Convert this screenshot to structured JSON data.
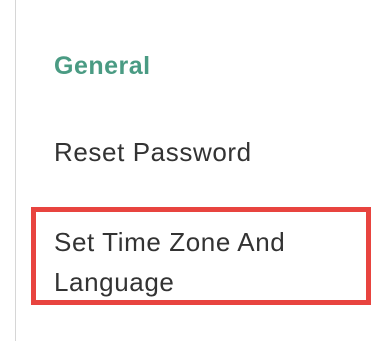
{
  "sidebar": {
    "section_title": "General",
    "items": [
      {
        "label": "Reset Password"
      },
      {
        "label": "Set Time Zone And Language"
      }
    ]
  },
  "colors": {
    "section_title": "#4a9b83",
    "item_text": "#333333",
    "highlight_border": "#e8443f",
    "panel_border": "#d6d6d6"
  }
}
